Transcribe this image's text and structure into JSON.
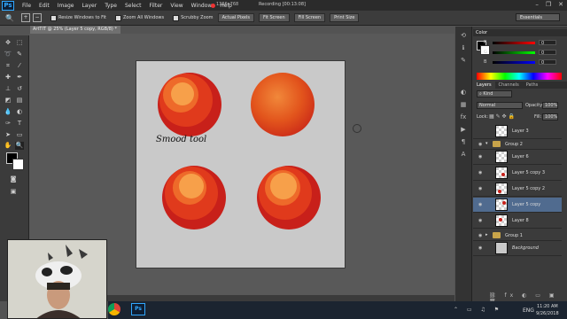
{
  "app": {
    "logo": "Ps",
    "menu": [
      "File",
      "Edit",
      "Image",
      "Layer",
      "Type",
      "Select",
      "Filter",
      "View",
      "Window",
      "Help"
    ],
    "recording": "Recording [00:13:08]",
    "resolution": "1366x768",
    "window_controls": [
      "–",
      "❐",
      "✕"
    ]
  },
  "options_bar": {
    "resize_windows": "Resize Windows to Fit",
    "zoom_all": "Zoom All Windows",
    "scrubby_zoom": "Scrubby Zoom",
    "actual_pixels": "Actual Pixels",
    "fit_screen": "Fit Screen",
    "fill_screen": "Fill Screen",
    "print_size": "Print Size",
    "workspace": "Essentials"
  },
  "document": {
    "tab": "ArtTIT @ 25% (Layer 5 copy, RGB/8) *",
    "annotation": "Smood tool"
  },
  "color_panel": {
    "title": "Color",
    "r_label": "R",
    "g_label": "G",
    "b_label": "B",
    "r_value": "0",
    "g_value": "0",
    "b_value": "0"
  },
  "layers_panel": {
    "tabs": [
      "Layers",
      "Channels",
      "Paths"
    ],
    "filter": "Kind",
    "blend_mode": "Normal",
    "opacity_label": "Opacity:",
    "opacity_value": "100%",
    "lock_label": "Lock:",
    "fill_label": "Fill:",
    "fill_value": "100%",
    "layers": [
      {
        "name": "Layer 3"
      },
      {
        "name": "Group 2"
      },
      {
        "name": "Layer 6"
      },
      {
        "name": "Layer 5 copy 3"
      },
      {
        "name": "Layer 5 copy 2"
      },
      {
        "name": "Layer 5 copy"
      },
      {
        "name": "Layer 8"
      },
      {
        "name": "Group 1"
      },
      {
        "name": "Background"
      }
    ]
  },
  "taskbar": {
    "ps": "Ps",
    "lang": "ENG",
    "time": "11:20 AM",
    "date": "9/26/2018"
  },
  "colors": {
    "accent": "#31a8ff",
    "ball_dark": "#c8201a",
    "ball_mid": "#e24a18",
    "ball_light": "#f7a04a",
    "selected_layer": "#506b8f"
  }
}
